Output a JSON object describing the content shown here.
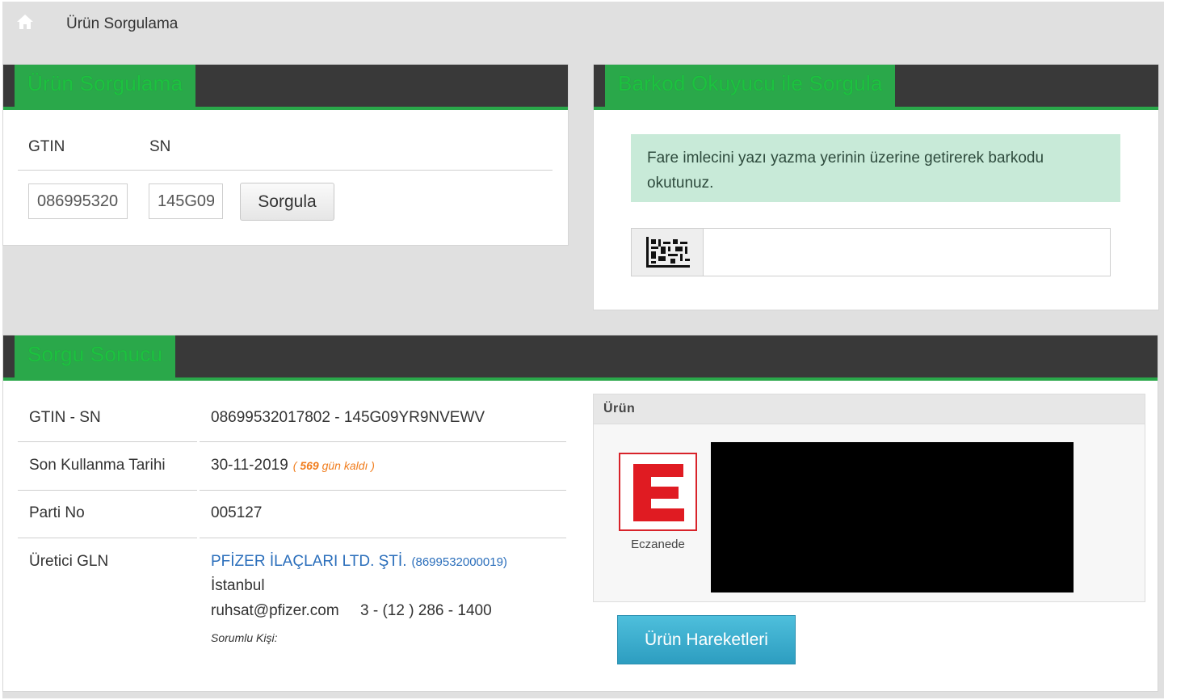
{
  "breadcrumb": {
    "icon": "home-icon",
    "text": "Ürün Sorgulama"
  },
  "query_panel": {
    "title": "Ürün Sorgulama",
    "gtin_label": "GTIN",
    "sn_label": "SN",
    "gtin_value": "086995320",
    "sn_value": "145G09",
    "submit_label": "Sorgula"
  },
  "barcode_panel": {
    "title": "Barkod Okuyucu ile Sorgula",
    "hint": "Fare imlecini yazı yazma yerinin üzerine getirerek barkodu okutunuz.",
    "scan_icon": "datamatrix-icon",
    "scan_value": ""
  },
  "result_panel": {
    "title": "Sorgu Sonucu",
    "rows": {
      "gtin_sn": {
        "label": "GTIN - SN",
        "value": "08699532017802 - 145G09YR9NVEWV"
      },
      "expiry": {
        "label": "Son Kullanma Tarihi",
        "value": "30-11-2019",
        "note_open": "( ",
        "days": "569",
        "note_text": " gün kaldı )"
      },
      "lot": {
        "label": "Parti No",
        "value": "005127"
      },
      "manufacturer": {
        "label": "Üretici GLN",
        "company": "PFİZER İLAÇLARI LTD. ŞTİ.",
        "gln": "(8699532000019)",
        "city": "İstanbul",
        "email": "ruhsat@pfizer.com",
        "phone": "3 - (12 ) 286 - 1400",
        "responsible": "Sorumlu Kişi:"
      }
    },
    "product": {
      "header": "Ürün",
      "status_icon": "eczane-e-icon",
      "status_letter": "E",
      "status_label": "Eczanede"
    },
    "movements_button": "Ürün Hareketleri"
  },
  "colors": {
    "accent_green": "#2aa84a",
    "header_dark": "#393939",
    "info_blue": "#2d9dc0",
    "warning_orange": "#f07c1c",
    "eczane_red": "#d8232a"
  }
}
